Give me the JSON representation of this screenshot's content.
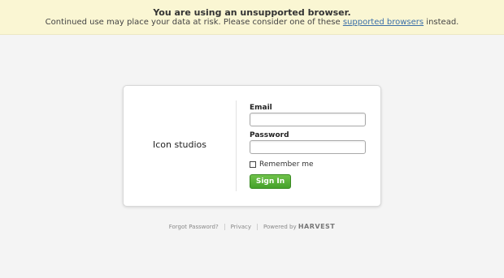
{
  "banner": {
    "title": "You are using an unsupported browser.",
    "message_before": "Continued use may place your data at risk. Please consider one of these ",
    "link_text": "supported browsers",
    "message_after": " instead."
  },
  "card": {
    "company_name": "Icon studios",
    "email_label": "Email",
    "email_value": "",
    "password_label": "Password",
    "password_value": "",
    "remember_label": "Remember me",
    "remember_checked": false,
    "sign_in_label": "Sign In"
  },
  "footer": {
    "forgot_password": "Forgot Password?",
    "privacy": "Privacy",
    "powered_by": "Powered by",
    "brand": "HARVEST"
  },
  "colors": {
    "banner_bg": "#faf6d3",
    "page_bg": "#f4f4f4",
    "signin_green": "#44a12a",
    "link_blue": "#3b6fa8"
  }
}
